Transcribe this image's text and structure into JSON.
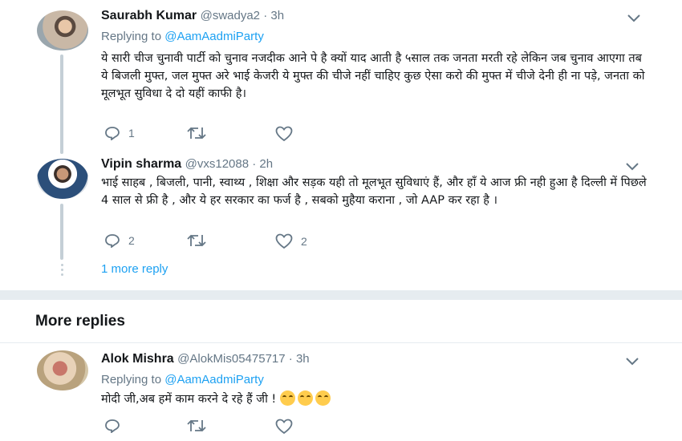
{
  "tweets": [
    {
      "name": "Saurabh Kumar",
      "handle": "@swadya2 · 3h",
      "replying_prefix": "Replying to ",
      "replying_to": "@AamAadmiParty",
      "text": "ये सारी चीज चुनावी पार्टी को चुनाव नजदीक आने पे है क्यों याद आती है ५साल तक जनता मरती रहे लेकिन जब चुनाव आएगा तब ये बिजली मुफ्त, जल मुफ्त अरे भाई केजरी ये मुफ्त की चीजे नहीं चाहिए कुछ ऐसा करो की मुफ्त में चीजे देनी ही ना पड़े, जनता को मूलभूत सुविधा दे दो यहीं काफी है।",
      "replies": "1",
      "retweets": "",
      "likes": ""
    },
    {
      "name": "Vipin sharma",
      "handle": "@vxs12088 · 2h",
      "text": "भाई साहब , बिजली, पानी, स्वाथ्य , शिक्षा और सड़क यही तो मूलभूत सुविधाएं हैं, और हाँ ये आज फ्री नही हुआ है दिल्ली में पिछले 4 साल से फ्री है , और ये हर सरकार का फर्ज है , सबको मुहैया कराना , जो AAP कर रहा है ।",
      "replies": "2",
      "retweets": "",
      "likes": "2"
    },
    {
      "name": "Alok Mishra",
      "handle": "@AlokMis05475717 · 3h",
      "replying_prefix": "Replying to ",
      "replying_to": "@AamAadmiParty",
      "text": "मोदी जी,अब हमें काम करने दे रहे हैं जी !",
      "emojis": [
        "smiling-face",
        "smiling-face",
        "smiling-face"
      ],
      "replies": "",
      "retweets": "",
      "likes": ""
    }
  ],
  "more_reply_link": "1 more reply",
  "more_replies_heading": "More replies",
  "colors": {
    "accent": "#1da1f2",
    "muted": "#657786",
    "line": "#c4cfd6",
    "separator": "#e6ecf0"
  }
}
